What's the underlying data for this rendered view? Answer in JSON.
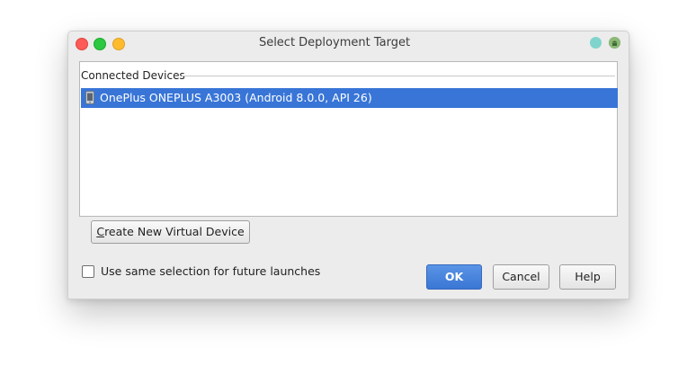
{
  "window": {
    "title": "Select Deployment Target"
  },
  "device_list": {
    "group_header": "Connected Devices",
    "devices": [
      {
        "label": "OnePlus ONEPLUS A3003 (Android 8.0.0, API 26)",
        "selected": true
      }
    ]
  },
  "buttons": {
    "create_first": "C",
    "create_rest": "reate New Virtual Device",
    "ok": "OK",
    "cancel": "Cancel",
    "help": "Help"
  },
  "options": {
    "same_selection_label": "Use same selection for future launches",
    "same_selection_checked": false
  },
  "icons": {
    "device": "phone-icon",
    "title_right_1": "round-teal-icon",
    "title_right_2": "android-studio-icon"
  },
  "colors": {
    "selection": "#3875d7",
    "ok_button": "#3a76d4",
    "close": "#fc5b57",
    "minimize": "#2bc840",
    "maximize": "#febb2e"
  }
}
